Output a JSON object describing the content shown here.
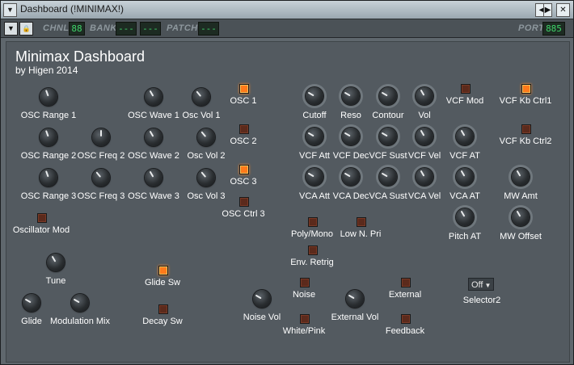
{
  "window": {
    "title": "Dashboard (!MINIMAX!)",
    "btn_prev": "◀",
    "btn_next": "▶",
    "btn_close": "✕",
    "menu_icon": "▼"
  },
  "toolbar": {
    "menu_icon": "▼",
    "lock_icon": "🔒",
    "chnl_label": "CHNL",
    "chnl_value": "88",
    "bank_label": "BANK",
    "bank_value1": "---",
    "bank_value2": "---",
    "patch_label": "PATCH",
    "patch_value": "---",
    "port_label": "PORT",
    "port_value": "885"
  },
  "header": {
    "title": "Minimax Dashboard",
    "subtitle": "by Higen 2014"
  },
  "knobs": [
    {
      "label": "OSC Range 1",
      "rot": -20
    },
    {
      "label": "OSC Wave 1",
      "rot": -30
    },
    {
      "label": "Osc Vol 1",
      "rot": -40
    },
    {
      "label": "OSC Range 2",
      "rot": -20
    },
    {
      "label": "OSC Freq 2",
      "rot": 0
    },
    {
      "label": "OSC Wave 2",
      "rot": -30
    },
    {
      "label": "Osc Vol 2",
      "rot": -40
    },
    {
      "label": "OSC Range 3",
      "rot": -20
    },
    {
      "label": "OSC Freq 3",
      "rot": -40
    },
    {
      "label": "OSC Wave 3",
      "rot": -30
    },
    {
      "label": "Osc Vol 3",
      "rot": -40
    },
    {
      "label": "Tune",
      "rot": -30
    },
    {
      "label": "Glide",
      "rot": -60
    },
    {
      "label": "Modulation Mix",
      "rot": -60
    },
    {
      "label": "Cutoff",
      "rot": -60
    },
    {
      "label": "Reso",
      "rot": -60
    },
    {
      "label": "Contour",
      "rot": -60
    },
    {
      "label": "Vol",
      "rot": -30
    },
    {
      "label": "VCF Att",
      "rot": -60
    },
    {
      "label": "VCF Dec",
      "rot": -60
    },
    {
      "label": "VCF Sust",
      "rot": -60
    },
    {
      "label": "VCF Vel",
      "rot": -30
    },
    {
      "label": "VCF AT",
      "rot": -30
    },
    {
      "label": "VCA Att",
      "rot": -60
    },
    {
      "label": "VCA Dec",
      "rot": -60
    },
    {
      "label": "VCA Sust",
      "rot": -60
    },
    {
      "label": "VCA Vel",
      "rot": -30
    },
    {
      "label": "VCA AT",
      "rot": -30
    },
    {
      "label": "MW Amt",
      "rot": -30
    },
    {
      "label": "Pitch AT",
      "rot": -30
    },
    {
      "label": "MW Offset",
      "rot": -30
    },
    {
      "label": "Noise Vol",
      "rot": -60
    },
    {
      "label": "External Vol",
      "rot": -60
    }
  ],
  "switches": [
    {
      "label": "OSC 1",
      "on": true
    },
    {
      "label": "OSC 2",
      "on": false
    },
    {
      "label": "OSC 3",
      "on": true
    },
    {
      "label": "OSC Ctrl 3",
      "on": false
    },
    {
      "label": "Oscillator Mod",
      "on": false
    },
    {
      "label": "Glide Sw",
      "on": true
    },
    {
      "label": "Decay Sw",
      "on": false
    },
    {
      "label": "VCF Mod",
      "on": false
    },
    {
      "label": "VCF Kb Ctrl1",
      "on": true
    },
    {
      "label": "VCF Kb Ctrl2",
      "on": false
    },
    {
      "label": "Poly/Mono",
      "on": false
    },
    {
      "label": "Low N. Pri",
      "on": false
    },
    {
      "label": "Env. Retrig",
      "on": false
    },
    {
      "label": "Noise",
      "on": false
    },
    {
      "label": "External",
      "on": false
    },
    {
      "label": "White/Pink",
      "on": false
    },
    {
      "label": "Feedback",
      "on": false
    }
  ],
  "selector": {
    "value": "Off",
    "label": "Selector2"
  }
}
